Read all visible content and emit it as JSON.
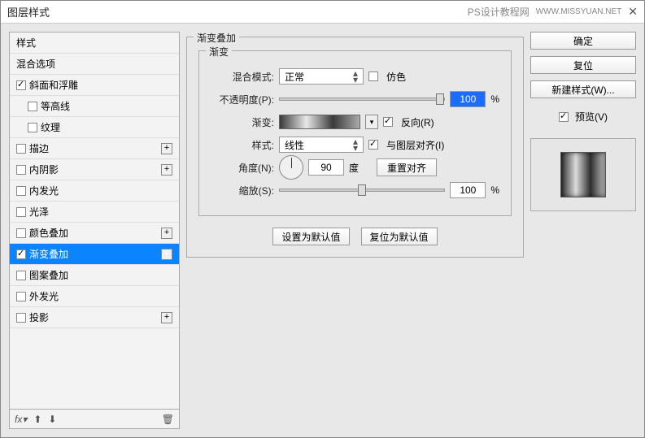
{
  "titlebar": {
    "title": "图层样式",
    "watermark1": "PS设计教程网",
    "watermark2": "WWW.MISSYUAN.NET"
  },
  "styles_panel": {
    "header": "样式",
    "items": [
      {
        "label": "混合选项",
        "checked": null,
        "plus": false,
        "indent": 0
      },
      {
        "label": "斜面和浮雕",
        "checked": true,
        "plus": false,
        "indent": 0
      },
      {
        "label": "等高线",
        "checked": false,
        "plus": false,
        "indent": 1
      },
      {
        "label": "纹理",
        "checked": false,
        "plus": false,
        "indent": 1
      },
      {
        "label": "描边",
        "checked": false,
        "plus": true,
        "indent": 0
      },
      {
        "label": "内阴影",
        "checked": false,
        "plus": true,
        "indent": 0
      },
      {
        "label": "内发光",
        "checked": false,
        "plus": false,
        "indent": 0
      },
      {
        "label": "光泽",
        "checked": false,
        "plus": false,
        "indent": 0
      },
      {
        "label": "颜色叠加",
        "checked": false,
        "plus": true,
        "indent": 0
      },
      {
        "label": "渐变叠加",
        "checked": true,
        "plus": true,
        "indent": 0,
        "selected": true
      },
      {
        "label": "图案叠加",
        "checked": false,
        "plus": false,
        "indent": 0
      },
      {
        "label": "外发光",
        "checked": false,
        "plus": false,
        "indent": 0
      },
      {
        "label": "投影",
        "checked": false,
        "plus": true,
        "indent": 0
      }
    ]
  },
  "center": {
    "section_title": "渐变叠加",
    "group_title": "渐变",
    "blend_mode_label": "混合模式:",
    "blend_mode_value": "正常",
    "dither_label": "仿色",
    "opacity_label": "不透明度(P):",
    "opacity_value": "100",
    "percent": "%",
    "gradient_label": "渐变:",
    "reverse_label": "反向(R)",
    "style_label": "样式:",
    "style_value": "线性",
    "align_label": "与图层对齐(I)",
    "angle_label": "角度(N):",
    "angle_value": "90",
    "angle_unit": "度",
    "reset_align_btn": "重置对齐",
    "scale_label": "缩放(S):",
    "scale_value": "100",
    "set_default_btn": "设置为默认值",
    "reset_default_btn": "复位为默认值"
  },
  "right": {
    "ok": "确定",
    "cancel": "复位",
    "new_style": "新建样式(W)...",
    "preview_label": "预览(V)"
  }
}
